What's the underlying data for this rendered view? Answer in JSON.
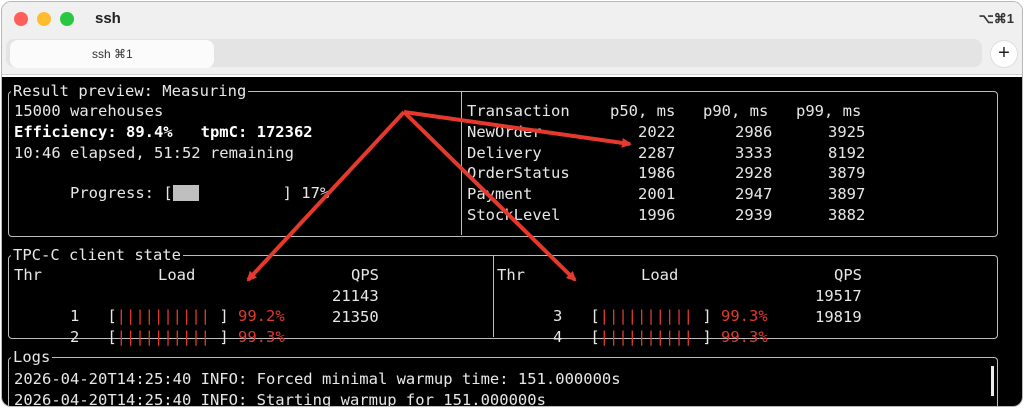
{
  "window": {
    "title": "ssh",
    "shortcut": "⌥⌘1"
  },
  "tab": {
    "label": "ssh ⌘1",
    "new_tab": "+"
  },
  "result": {
    "title": "Result preview: Measuring",
    "warehouses": "15000 warehouses",
    "efficiency": "Efficiency: 89.4%   tpmC: 172362",
    "elapsed": "10:46 elapsed, 51:52 remaining",
    "progress_label": "Progress: [",
    "progress_end": "         ] 17%",
    "progress_percent": 17
  },
  "latency": {
    "headers": [
      "Transaction",
      "p50, ms",
      "p90, ms",
      "p99, ms"
    ],
    "rows": [
      [
        "NewOrder",
        "2022",
        "2986",
        "3925"
      ],
      [
        "Delivery",
        "2287",
        "3333",
        "8192"
      ],
      [
        "OrderStatus",
        "1986",
        "2928",
        "3879"
      ],
      [
        "Payment",
        "2001",
        "2947",
        "3897"
      ],
      [
        "StockLevel",
        "1996",
        "2939",
        "3882"
      ]
    ]
  },
  "client": {
    "title": "TPC-C client state",
    "headers": {
      "thr": "Thr",
      "load": "Load",
      "qps": "QPS"
    },
    "left": [
      {
        "thr": "1",
        "bar": "||||||||||",
        "load": "99.2%",
        "qps": "21143"
      },
      {
        "thr": "2",
        "bar": "||||||||||",
        "load": "99.3%",
        "qps": "21350"
      }
    ],
    "right": [
      {
        "thr": "3",
        "bar": "||||||||||",
        "load": "99.3%",
        "qps": "19517"
      },
      {
        "thr": "4",
        "bar": "||||||||||",
        "load": "99.3%",
        "qps": "19819"
      }
    ]
  },
  "logs": {
    "title": "Logs",
    "lines": [
      "2026-04-20T14:25:40 INFO: Forced minimal warmup time: 151.000000s",
      "2026-04-20T14:25:40 INFO: Starting warmup for 151.000000s"
    ]
  },
  "colors": {
    "arrow": "#e5392e",
    "load": "#e03a2f",
    "terminal_bg": "#000000"
  }
}
